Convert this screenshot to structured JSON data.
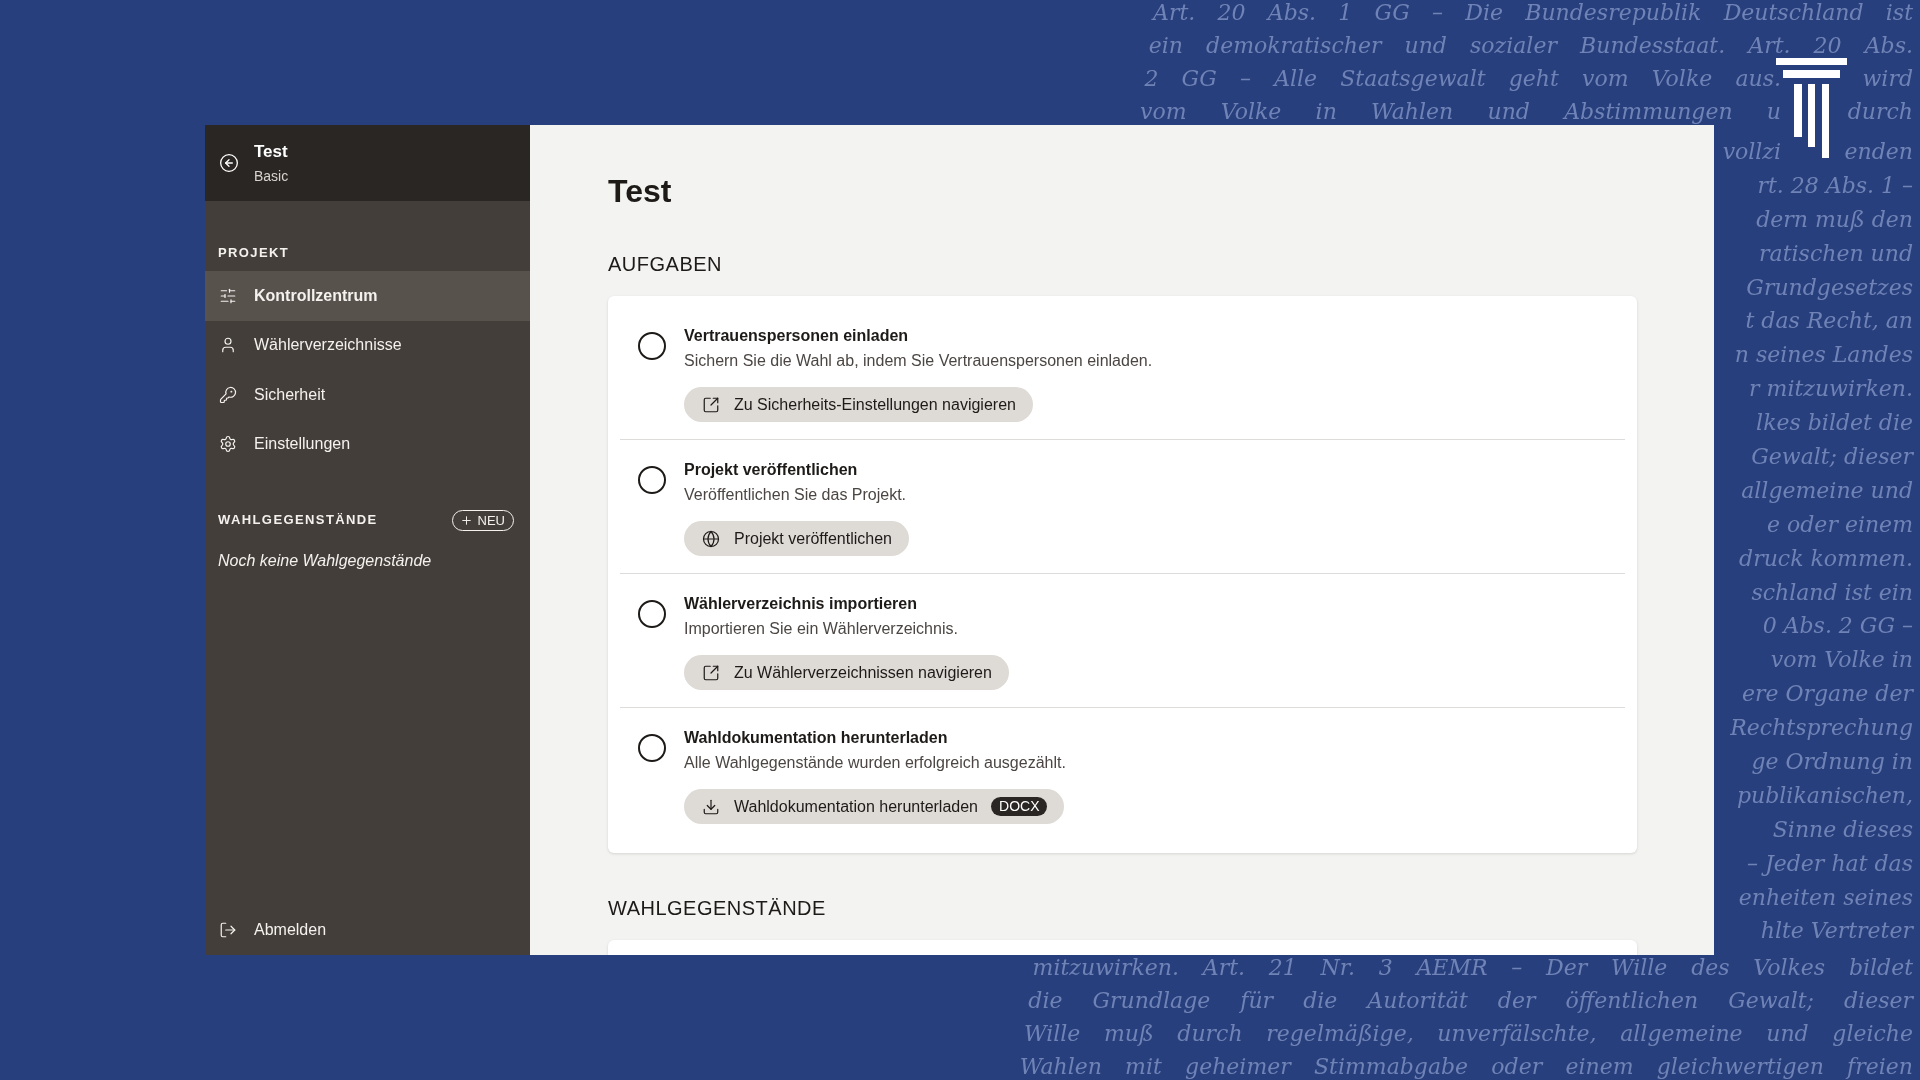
{
  "background_text": {
    "top_lines": [
      [
        "Art. 20 Abs. 1 GG – Die Bundesrepublik Deutschland ist"
      ],
      [
        "ein demokratischer und sozialer Bundesstaat. Art. 20 Abs."
      ],
      [
        "2 GG – Alle Staatsgewalt geht vom Volke aus.",
        "wird"
      ],
      [
        "vom Volke in Wahlen und Abstimmungen u",
        "durch"
      ]
    ],
    "side_fragments": [
      [
        "vollzi",
        "enden"
      ],
      [
        "rt. 28 Abs. 1 –"
      ],
      [
        "dern muß den"
      ],
      [
        "ratischen und"
      ],
      [
        "Grundgesetzes"
      ],
      [
        "t das Recht, an"
      ],
      [
        "n seines Landes"
      ],
      [
        "r mitzuwirken."
      ],
      [
        "lkes bildet die"
      ],
      [
        "Gewalt; dieser"
      ],
      [
        "allgemeine und"
      ],
      [
        "e oder einem"
      ],
      [
        "druck kommen."
      ],
      [
        "schland ist ein"
      ],
      [
        "0 Abs. 2 GG –"
      ],
      [
        "vom Volke in"
      ],
      [
        "ere Organe der"
      ],
      [
        "Rechtsprechung"
      ],
      [
        "ge Ordnung in"
      ],
      [
        "publikanischen,"
      ],
      [
        "Sinne dieses"
      ],
      [
        "– Jeder hat das"
      ],
      [
        "enheiten seines"
      ],
      [
        "hlte Vertreter"
      ]
    ],
    "bottom_lines": [
      [
        "mitzuwirken. Art. 21 Nr. 3 AEMR – Der Wille des Volkes bildet"
      ],
      [
        "die Grundlage für die Autorität der öffentlichen Gewalt; dieser"
      ],
      [
        "Wille muß durch regelmäßige, unverfälschte, allgemeine und gleiche"
      ],
      [
        "Wahlen mit geheimer Stimmabgabe oder einem gleichwertigen freien"
      ]
    ]
  },
  "window": {
    "sidebar": {
      "header": {
        "title": "Test",
        "subtitle": "Basic"
      },
      "project_section": {
        "heading": "PROJEKT",
        "items": [
          {
            "label": "Kontrollzentrum",
            "selected": true
          },
          {
            "label": "Wählerverzeichnisse",
            "selected": false
          },
          {
            "label": "Sicherheit",
            "selected": false
          },
          {
            "label": "Einstellungen",
            "selected": false
          }
        ]
      },
      "ballot_section": {
        "heading": "WAHLGEGENSTÄNDE",
        "new_button": "NEU",
        "empty_text": "Noch keine Wahlgegenstände"
      },
      "logout": "Abmelden"
    },
    "main": {
      "title": "Test",
      "tasks_heading": "AUFGABEN",
      "tasks": [
        {
          "title": "Vertrauenspersonen einladen",
          "description": "Sichern Sie die Wahl ab, indem Sie Vertrauenspersonen einladen.",
          "done": false,
          "action": {
            "kind": "link",
            "label": "Zu Sicherheits-Einstellungen navigieren"
          }
        },
        {
          "title": "Projekt veröffentlichen",
          "description": "Veröffentlichen Sie das Projekt.",
          "done": false,
          "action": {
            "kind": "publish",
            "label": "Projekt veröffentlichen"
          }
        },
        {
          "title": "Wählerverzeichnis importieren",
          "description": "Importieren Sie ein Wählerverzeichnis.",
          "done": false,
          "action": {
            "kind": "link",
            "label": "Zu Wählerverzeichnissen navigieren"
          }
        },
        {
          "title": "Wahldokumentation herunterladen",
          "description": "Alle Wahlgegenstände wurden erfolgreich ausgezählt.",
          "done": false,
          "action": {
            "kind": "download",
            "label": "Wahldokumentation herunterladen",
            "badge": "DOCX"
          }
        }
      ],
      "ballots_heading": "WAHLGEGENSTÄNDE"
    }
  }
}
